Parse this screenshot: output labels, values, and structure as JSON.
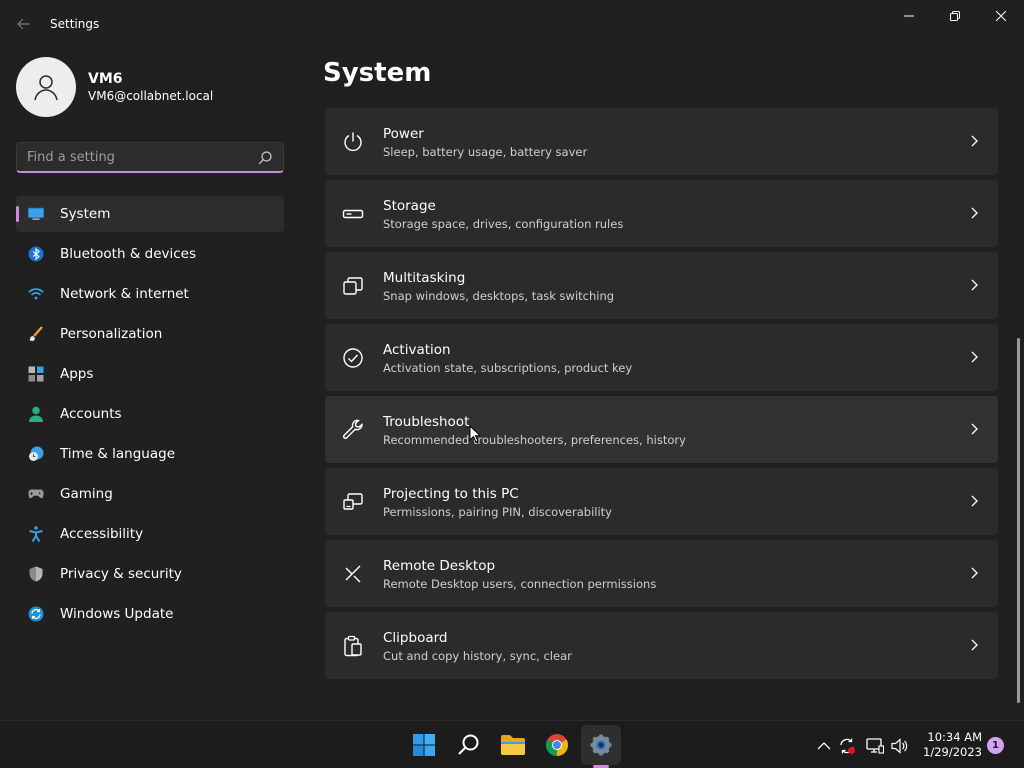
{
  "window": {
    "title": "Settings",
    "back_icon": "arrow-left-icon",
    "controls": [
      "minimize-icon",
      "restore-icon",
      "close-icon"
    ]
  },
  "profile": {
    "name": "VM6",
    "email": "VM6@collabnet.local"
  },
  "search": {
    "placeholder": "Find a setting",
    "value": ""
  },
  "sidebar": {
    "items": [
      {
        "label": "System",
        "icon": "monitor-icon",
        "active": true
      },
      {
        "label": "Bluetooth & devices",
        "icon": "bluetooth-icon"
      },
      {
        "label": "Network & internet",
        "icon": "wifi-icon"
      },
      {
        "label": "Personalization",
        "icon": "brush-icon"
      },
      {
        "label": "Apps",
        "icon": "apps-icon"
      },
      {
        "label": "Accounts",
        "icon": "person-icon"
      },
      {
        "label": "Time & language",
        "icon": "globe-clock-icon"
      },
      {
        "label": "Gaming",
        "icon": "gamepad-icon"
      },
      {
        "label": "Accessibility",
        "icon": "accessibility-icon"
      },
      {
        "label": "Privacy & security",
        "icon": "shield-icon"
      },
      {
        "label": "Windows Update",
        "icon": "update-icon"
      }
    ]
  },
  "main": {
    "title": "System",
    "cards": [
      {
        "title": "Power",
        "subtitle": "Sleep, battery usage, battery saver",
        "icon": "power-icon"
      },
      {
        "title": "Storage",
        "subtitle": "Storage space, drives, configuration rules",
        "icon": "storage-icon"
      },
      {
        "title": "Multitasking",
        "subtitle": "Snap windows, desktops, task switching",
        "icon": "multitasking-icon"
      },
      {
        "title": "Activation",
        "subtitle": "Activation state, subscriptions, product key",
        "icon": "check-circle-icon"
      },
      {
        "title": "Troubleshoot",
        "subtitle": "Recommended troubleshooters, preferences, history",
        "icon": "wrench-icon"
      },
      {
        "title": "Projecting to this PC",
        "subtitle": "Permissions, pairing PIN, discoverability",
        "icon": "projecting-icon"
      },
      {
        "title": "Remote Desktop",
        "subtitle": "Remote Desktop users, connection permissions",
        "icon": "remote-desktop-icon"
      },
      {
        "title": "Clipboard",
        "subtitle": "Cut and copy history, sync, clear",
        "icon": "clipboard-icon"
      }
    ]
  },
  "taskbar": {
    "apps": [
      "windows-start-icon",
      "search-icon",
      "file-explorer-icon",
      "chrome-icon",
      "settings-gear-icon"
    ],
    "tray": [
      "chevron-up-icon",
      "sync-error-icon",
      "network-icon",
      "volume-icon"
    ],
    "time": "10:34 AM",
    "date": "1/29/2023",
    "notification_count": "1"
  },
  "colors": {
    "accent": "#d088e6",
    "background": "#202020",
    "card": "#2b2b2b"
  }
}
